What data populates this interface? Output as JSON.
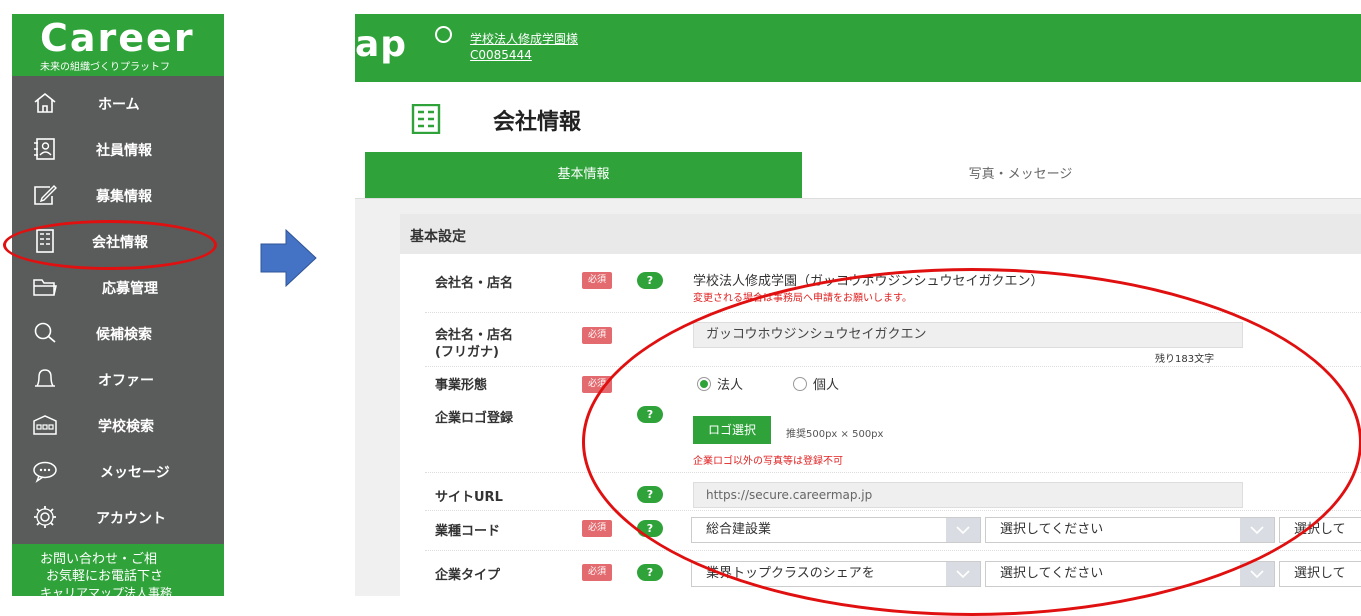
{
  "sidebar": {
    "logo": "Career",
    "tagline": "未来の組織づくりプラットフ",
    "items": [
      {
        "label": "ホーム",
        "icon": "home-icon"
      },
      {
        "label": "社員情報",
        "icon": "employee-icon"
      },
      {
        "label": "募集情報",
        "icon": "edit-icon"
      },
      {
        "label": "会社情報",
        "icon": "building-icon"
      },
      {
        "label": "応募管理",
        "icon": "folder-icon"
      },
      {
        "label": "候補検索",
        "icon": "search-icon"
      },
      {
        "label": "オファー",
        "icon": "bell-icon"
      },
      {
        "label": "学校検索",
        "icon": "school-icon"
      },
      {
        "label": "メッセージ",
        "icon": "chat-icon"
      },
      {
        "label": "アカウント",
        "icon": "gear-icon"
      }
    ],
    "footer_lines": [
      "お問い合わせ・ご相",
      "お気軽にお電話下さ",
      "キャリアマップ法人事務"
    ]
  },
  "topbar": {
    "logo_fragment": "ap",
    "school_name": "学校法人修成学園様",
    "school_code": "C0085444"
  },
  "page": {
    "title": "会社情報"
  },
  "tabs": [
    {
      "label": "基本情報",
      "active": true
    },
    {
      "label": "写真・メッセージ",
      "active": false
    }
  ],
  "form": {
    "section_title": "基本設定",
    "required_badge": "必須",
    "help_badge": "?",
    "company_name": {
      "label": "会社名・店名",
      "value": "学校法人修成学園（ガッコウホウジンシュウセイガクエン）",
      "warning": "変更される場合は事務局へ申請をお願いします。"
    },
    "company_kana": {
      "label_line1": "会社名・店名",
      "label_line2": "(フリガナ)",
      "value": "ガッコウホウジンシュウセイガクエン",
      "remaining": "残り183文字"
    },
    "business_type": {
      "label": "事業形態",
      "options": [
        "法人",
        "個人"
      ],
      "selected": "法人"
    },
    "logo": {
      "label": "企業ロゴ登録",
      "button": "ロゴ選択",
      "recommended": "推奨500px × 500px",
      "warning": "企業ロゴ以外の写真等は登録不可"
    },
    "site_url": {
      "label": "サイトURL",
      "value": "https://secure.careermap.jp"
    },
    "industry_code": {
      "label": "業種コード",
      "select1": "総合建設業",
      "select2": "選択してください",
      "select3": "選択して"
    },
    "company_type": {
      "label": "企業タイプ",
      "select1": "業界トップクラスのシェアを",
      "select2": "選択してください",
      "select3": "選択して"
    }
  },
  "colors": {
    "brand_green": "#2fa33a",
    "sidebar_gray": "#595c5a",
    "required_red": "#e36b70",
    "highlight_red": "#e01010",
    "arrow_blue": "#4472c4"
  }
}
